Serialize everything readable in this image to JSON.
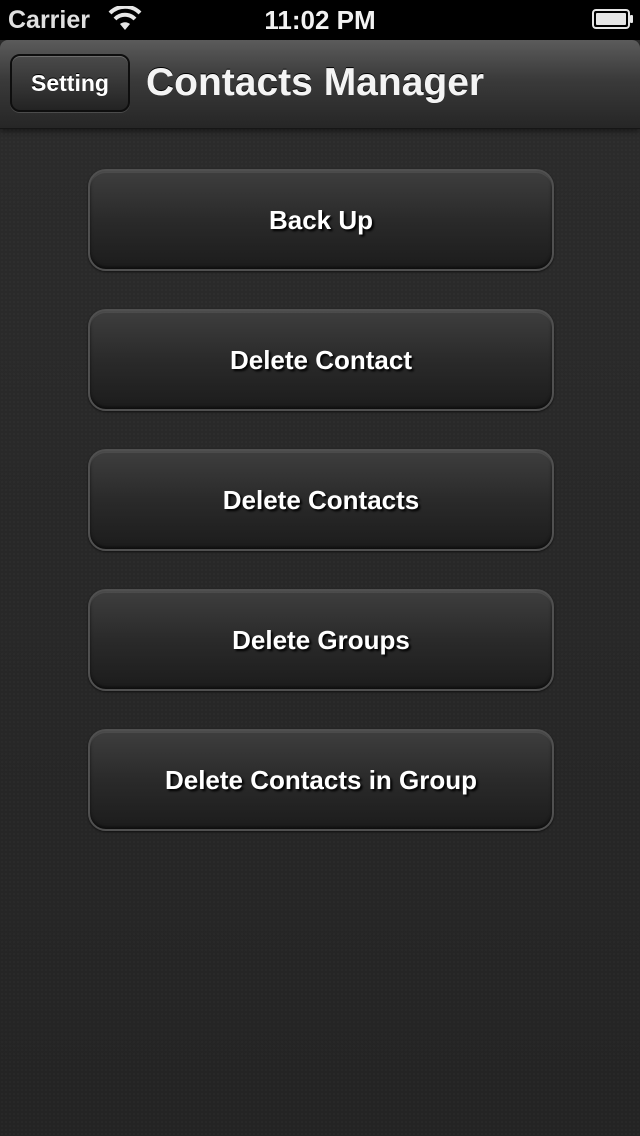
{
  "status_bar": {
    "carrier": "Carrier",
    "time": "11:02 PM",
    "wifi_icon": "wifi-icon",
    "battery_icon": "battery-icon"
  },
  "nav_bar": {
    "left_button_label": "Setting",
    "title": "Contacts Manager"
  },
  "actions": [
    {
      "label": "Back Up"
    },
    {
      "label": "Delete Contact"
    },
    {
      "label": "Delete Contacts"
    },
    {
      "label": "Delete Groups"
    },
    {
      "label": "Delete Contacts in Group"
    }
  ],
  "colors": {
    "background": "#2a2a2a",
    "status_bar": "#000000",
    "text": "#ffffff"
  }
}
